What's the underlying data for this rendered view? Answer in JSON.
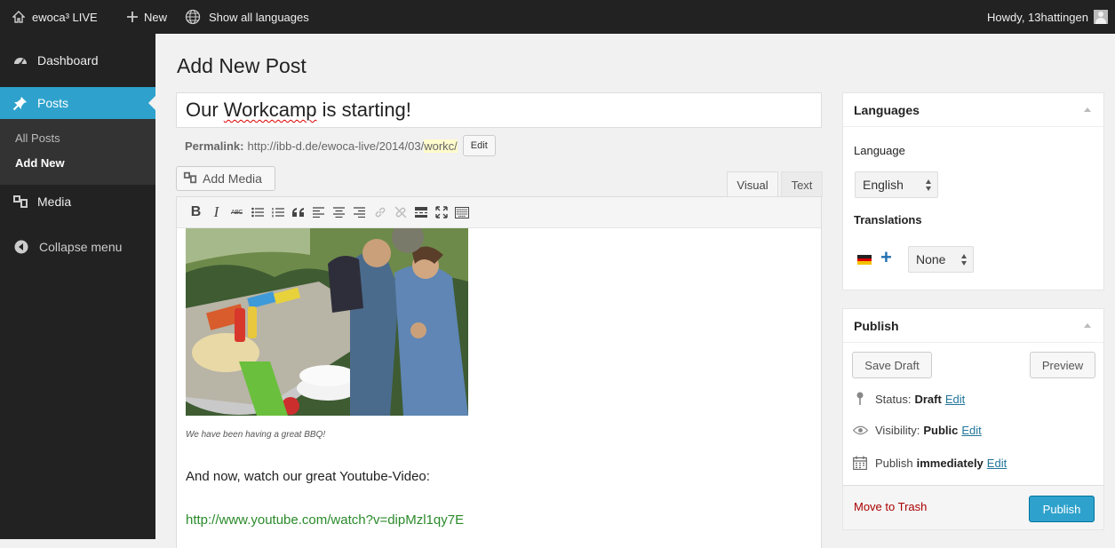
{
  "admin_bar": {
    "site_name": "ewoca³ LIVE",
    "new_label": "New",
    "languages_label": "Show all languages",
    "howdy": "Howdy, 13hattingen"
  },
  "sidebar": {
    "items": [
      {
        "label": "Dashboard",
        "icon": "dashboard-icon"
      },
      {
        "label": "Posts",
        "icon": "pin-icon",
        "active": true
      },
      {
        "label": "Media",
        "icon": "media-icon"
      },
      {
        "label": "Collapse menu",
        "icon": "collapse-icon"
      }
    ],
    "posts_submenu": [
      {
        "label": "All Posts"
      },
      {
        "label": "Add New",
        "current": true
      }
    ]
  },
  "page_title": "Add New Post",
  "post": {
    "title_before": "Our ",
    "title_misspelled": "Workcamp",
    "title_after": " is starting!",
    "permalink_label": "Permalink:",
    "permalink_base": "http://ibb-d.de/ewoca-live/2014/03/",
    "permalink_slug": "workc/",
    "permalink_edit": "Edit"
  },
  "editor": {
    "add_media": "Add Media",
    "tab_visual": "Visual",
    "tab_text": "Text",
    "toolbar": {
      "bold": "B",
      "italic": "I",
      "strike": "ABC"
    },
    "caption": "We have been having a great BBQ!",
    "paragraph": "And now, watch our great Youtube-Video:",
    "link": "http://www.youtube.com/watch?v=dipMzl1qy7E"
  },
  "languages_box": {
    "title": "Languages",
    "language_label": "Language",
    "language_value": "English",
    "translations_label": "Translations",
    "translation_value": "None"
  },
  "publish_box": {
    "title": "Publish",
    "save_draft": "Save Draft",
    "preview": "Preview",
    "status_label": "Status:",
    "status_value": "Draft",
    "visibility_label": "Visibility:",
    "visibility_value": "Public",
    "publish_label": "Publish",
    "publish_value": "immediately",
    "edit": "Edit",
    "trash": "Move to Trash",
    "publish_button": "Publish"
  },
  "colors": {
    "admin_bar": "#222222",
    "active_menu": "#2ea2cc",
    "publish_button": "#2ea2cc",
    "trash": "#aa0000",
    "link": "#2a8a2a"
  }
}
